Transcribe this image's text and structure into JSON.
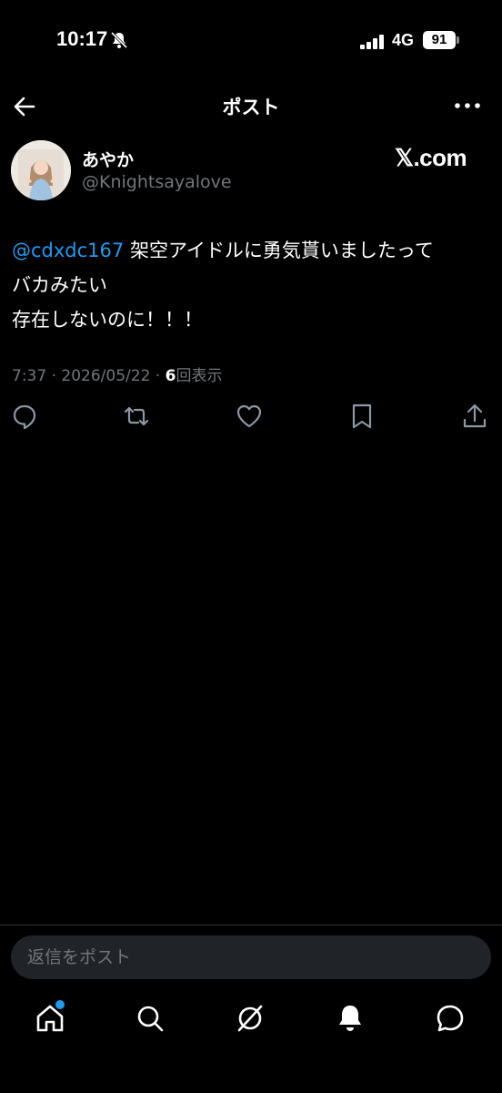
{
  "status_bar": {
    "time": "10:17",
    "network": "4G",
    "battery": "91"
  },
  "header": {
    "title": "ポスト"
  },
  "author": {
    "display_name": "あやか",
    "handle": "@Knightsayalove"
  },
  "watermark": "𝕏.com",
  "post": {
    "mention": "@cdxdc167",
    "line1_rest": " 架空アイドルに勇気貰いましたって",
    "line2": "バカみたい",
    "line3": "存在しないのに！！！",
    "time": "7:37",
    "separator": " · ",
    "date": "2026/05/22",
    "views_count": "6",
    "views_label": "回表示"
  },
  "actions": [
    "reply-icon",
    "repost-icon",
    "like-icon",
    "bookmark-icon",
    "share-icon"
  ],
  "reply_bar": {
    "placeholder": "返信をポスト"
  },
  "tab_bar": [
    "home-icon",
    "search-icon",
    "grok-icon",
    "notifications-icon",
    "messages-icon"
  ],
  "colors": {
    "accent": "#1d9bf0",
    "muted": "#71767b",
    "background": "#000000"
  }
}
